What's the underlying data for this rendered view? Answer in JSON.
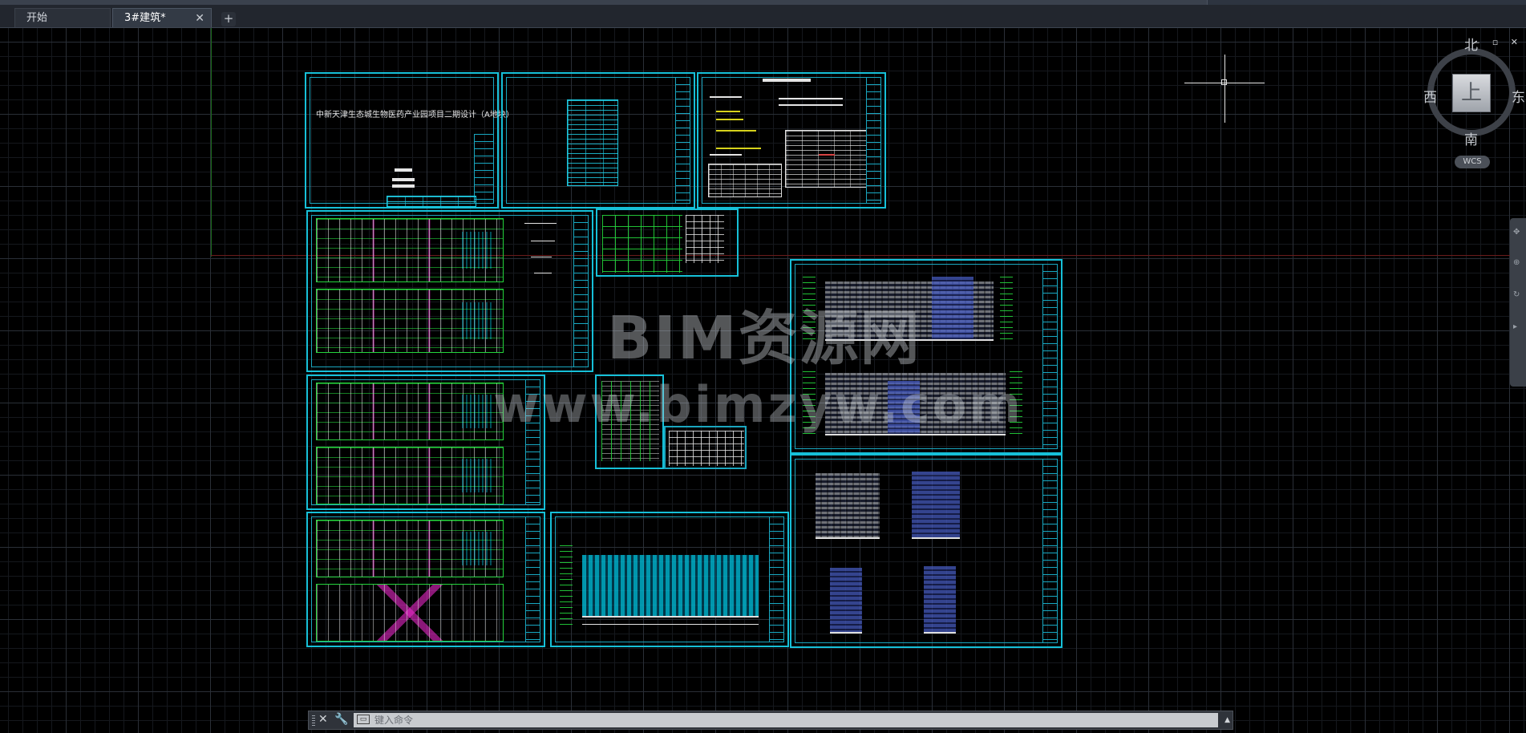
{
  "tabs": {
    "start_label": "开始",
    "active_label": "3#建筑*",
    "close_glyph": "✕",
    "add_glyph": "+"
  },
  "viewcube": {
    "north": "北",
    "south": "南",
    "west": "西",
    "east": "东",
    "face": "上",
    "wcs": "WCS",
    "window_controls": "‒ ▫ ✕"
  },
  "drawing": {
    "cover_title": "中新天津生态城生物医药产业园项目二期设计（A地块）",
    "colors": {
      "sheet_border": "#16c0d8",
      "plan_lines": "#24d43b",
      "accent_magenta": "#e828c8",
      "axis_x": "#6b1b1b",
      "axis_y": "#1b6b1b"
    }
  },
  "watermark": {
    "line1": "BIM资源网",
    "line2": "www.bimzyw.com"
  },
  "command_line": {
    "close_glyph": "✕",
    "wrench_glyph": "🔧",
    "prompt_icon": "▭",
    "placeholder": "键入命令",
    "scroll_glyph": "▲"
  }
}
